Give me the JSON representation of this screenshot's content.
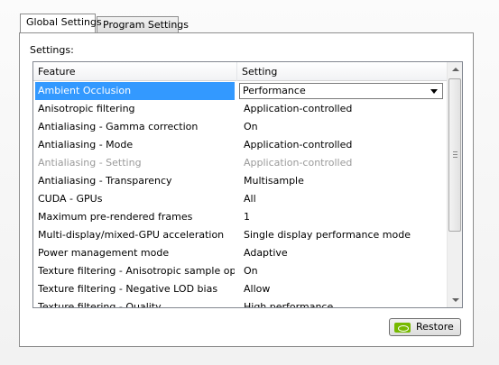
{
  "tabs": {
    "global": "Global Settings",
    "program": "Program Settings"
  },
  "settings_label": "Settings:",
  "columns": {
    "feature": "Feature",
    "setting": "Setting"
  },
  "rows": [
    {
      "feature": "Ambient Occlusion",
      "setting": "Performance",
      "state": "selected"
    },
    {
      "feature": "Anisotropic filtering",
      "setting": "Application-controlled",
      "state": "normal"
    },
    {
      "feature": "Antialiasing - Gamma correction",
      "setting": "On",
      "state": "normal"
    },
    {
      "feature": "Antialiasing - Mode",
      "setting": "Application-controlled",
      "state": "normal"
    },
    {
      "feature": "Antialiasing - Setting",
      "setting": "Application-controlled",
      "state": "disabled"
    },
    {
      "feature": "Antialiasing - Transparency",
      "setting": "Multisample",
      "state": "normal"
    },
    {
      "feature": "CUDA - GPUs",
      "setting": "All",
      "state": "normal"
    },
    {
      "feature": "Maximum pre-rendered frames",
      "setting": "1",
      "state": "normal"
    },
    {
      "feature": "Multi-display/mixed-GPU acceleration",
      "setting": "Single display performance mode",
      "state": "normal"
    },
    {
      "feature": "Power management mode",
      "setting": "Adaptive",
      "state": "normal"
    },
    {
      "feature": "Texture filtering - Anisotropic sample opti...",
      "setting": "On",
      "state": "normal"
    },
    {
      "feature": "Texture filtering - Negative LOD bias",
      "setting": "Allow",
      "state": "normal"
    },
    {
      "feature": "Texture filtering - Quality",
      "setting": "High performance",
      "state": "normal"
    }
  ],
  "restore": {
    "label": "Restore",
    "icon": "nvidia-logo-icon",
    "icon_color": "#76b900"
  },
  "colors": {
    "selection": "#3399ff",
    "disabled_text": "#9a9a9a"
  }
}
